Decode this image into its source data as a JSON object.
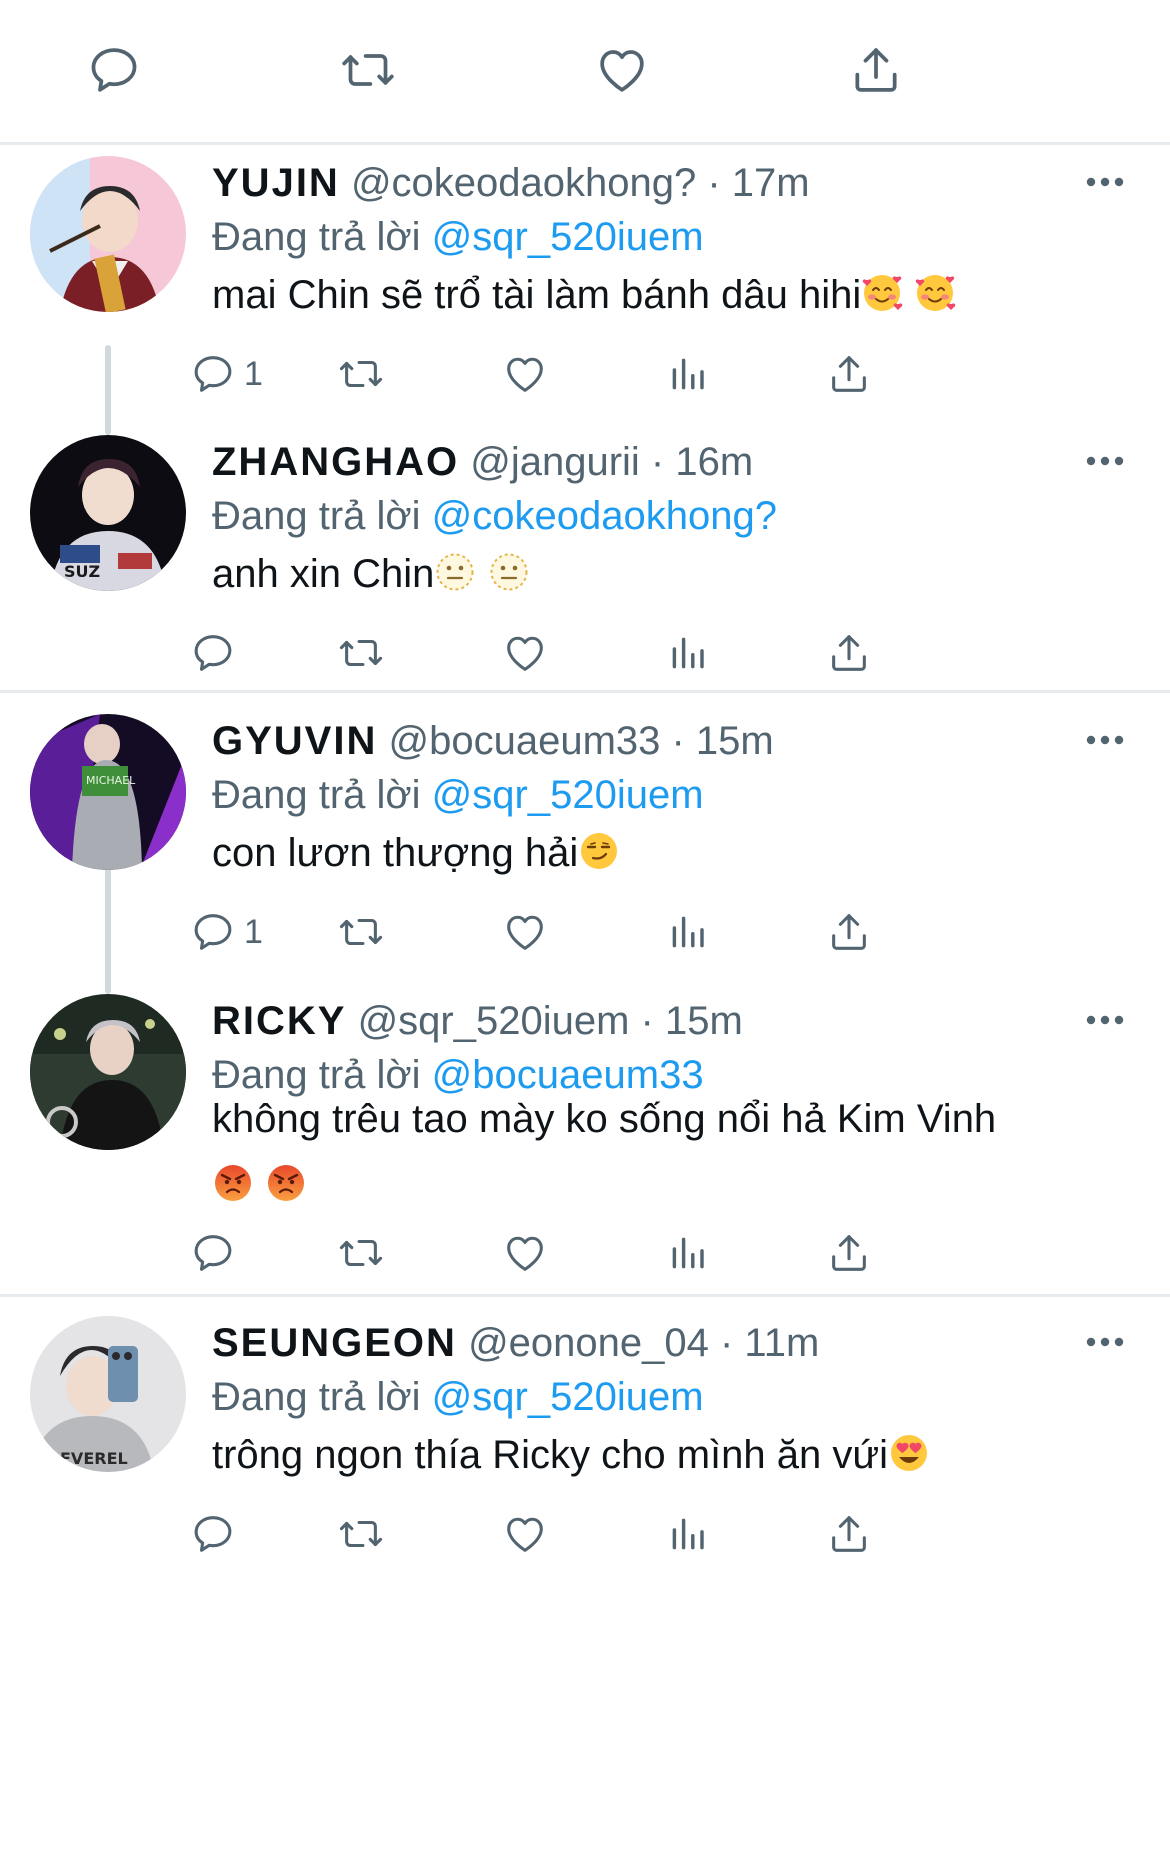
{
  "reply_prefix": "Đang trả lời",
  "tweets": [
    {
      "name": "YUJIN",
      "meta": "@cokeodaokhong? · 17m",
      "mention": "@sqr_520iuem",
      "text": "mai Chin sẽ trổ tài làm bánh dâu hihi",
      "emojis": [
        "smiling-face-with-hearts-icon",
        "smiling-face-with-hearts-icon"
      ],
      "reply_count": "1"
    },
    {
      "name": "ZHANGHAO",
      "meta": "@jangurii · 16m",
      "mention": "@cokeodaokhong?",
      "text": "anh xin Chin",
      "emojis": [
        "dotted-neutral-face-icon",
        "dotted-neutral-face-icon"
      ],
      "reply_count": ""
    },
    {
      "name": "GYUVIN",
      "meta": "@bocuaeum33 · 15m",
      "mention": "@sqr_520iuem",
      "text": "con lươn thượng hải",
      "emojis": [
        "smirking-face-icon"
      ],
      "reply_count": "1"
    },
    {
      "name": "RICKY",
      "meta": "@sqr_520iuem · 15m",
      "mention": "@bocuaeum33",
      "text": "không trêu tao mày ko sống nổi hả Kim Vinh",
      "emojis": [
        "angry-face-icon",
        "angry-face-icon"
      ],
      "reply_count": ""
    },
    {
      "name": "SEUNGEON",
      "meta": "@eonone_04 · 11m",
      "mention": "@sqr_520iuem",
      "text": "trông ngon thía Ricky cho mình ăn vứi",
      "emojis": [
        "heart-eyes-face-icon"
      ],
      "reply_count": ""
    }
  ],
  "colors": {
    "mention": "#1d9bf0",
    "secondary_text": "#536471",
    "divider": "#e8ebed"
  }
}
